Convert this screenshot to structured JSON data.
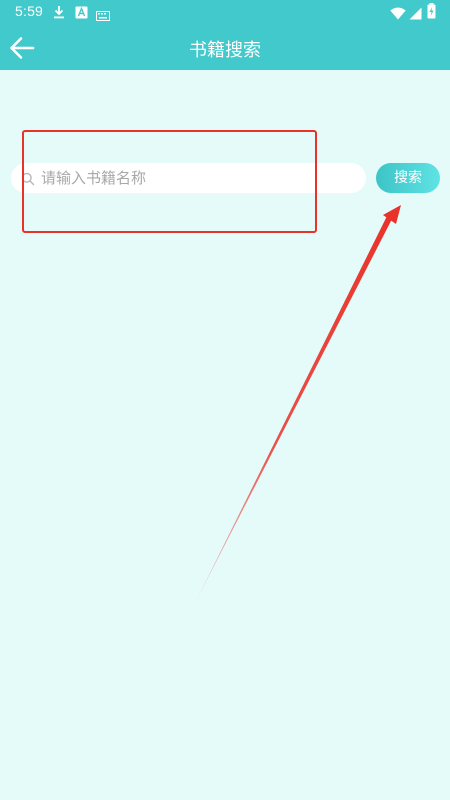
{
  "status_bar": {
    "time": "5:59",
    "left_icons": [
      "download-icon",
      "a-box-icon",
      "keyboard-icon"
    ],
    "right_icons": [
      "wifi-icon",
      "signal-icon",
      "battery-icon"
    ]
  },
  "header": {
    "title": "书籍搜索",
    "back_icon": "arrow-left-icon"
  },
  "search": {
    "placeholder": "请输入书籍名称",
    "value": "",
    "button_label": "搜索"
  },
  "colors": {
    "header_bg": "#42c9cb",
    "page_bg": "#e5fbfa",
    "annotation": "#e8322a"
  }
}
